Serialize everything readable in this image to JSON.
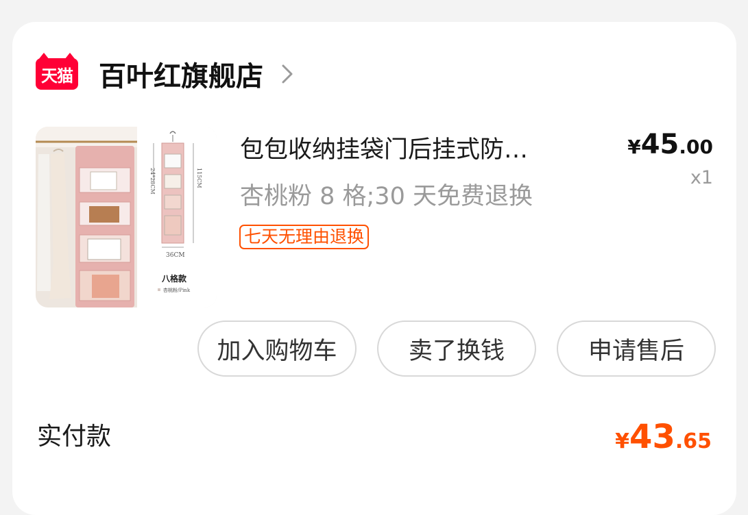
{
  "shop": {
    "logo_text": "天猫",
    "name": "百叶红旗舰店",
    "chevron_icon": "chevron-right-icon"
  },
  "product": {
    "title": "包包收纳挂袋门后挂式防…",
    "sku": "杏桃粉 8 格;30 天免费退换",
    "tag": "七天无理由退换",
    "price_symbol": "¥",
    "price_integer": "45",
    "price_decimal": ".00",
    "quantity": "x1",
    "image_labels": {
      "dim_top": "24*28CM",
      "dim_side": "115CM",
      "dim_bottom": "36CM",
      "style_name": "八格款",
      "color_name": "杏桃粉/Pink"
    }
  },
  "actions": {
    "add_cart": "加入购物车",
    "sell": "卖了换钱",
    "after_sale": "申请售后"
  },
  "payment": {
    "label": "实付款",
    "symbol": "¥",
    "integer": "43",
    "decimal": ".65"
  },
  "colors": {
    "accent": "#ff5000",
    "tmall_red": "#ff0036",
    "product_pink": "#e8b7b4"
  }
}
